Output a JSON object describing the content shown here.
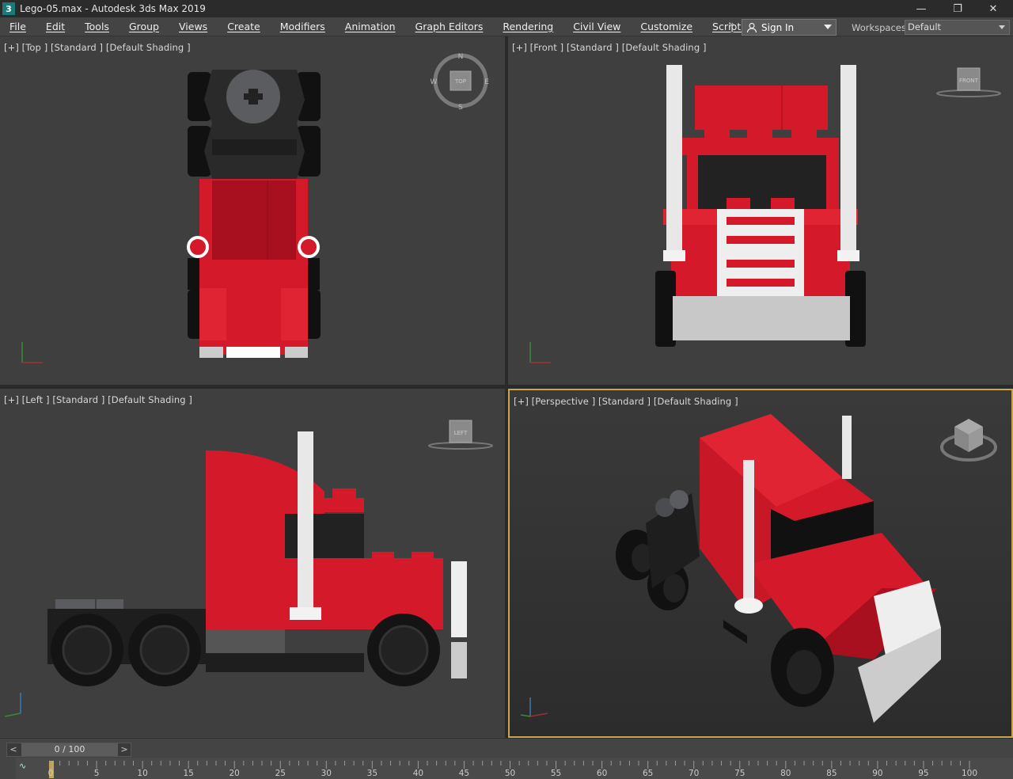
{
  "window": {
    "title": "Lego-05.max - Autodesk 3ds Max 2019",
    "app_icon": "3"
  },
  "menu": [
    "File",
    "Edit",
    "Tools",
    "Group",
    "Views",
    "Create",
    "Modifiers",
    "Animation",
    "Graph Editors",
    "Rendering",
    "Civil View",
    "Customize",
    "Scripting"
  ],
  "toolbar": {
    "overflow": "»",
    "sign_in": "Sign In",
    "workspaces_label": "Workspaces:",
    "workspace_value": "Default"
  },
  "viewports": {
    "top": {
      "label": "[+] [Top ] [Standard ] [Default Shading ]",
      "cube": "TOP",
      "compass": [
        "N",
        "E",
        "S",
        "W"
      ]
    },
    "front": {
      "label": "[+] [Front ] [Standard ] [Default Shading ]",
      "cube": "FRONT"
    },
    "left": {
      "label": "[+] [Left ] [Standard ] [Default Shading ]",
      "cube": "LEFT"
    },
    "perspective": {
      "label": "[+] [Perspective ] [Standard ] [Default Shading ]"
    }
  },
  "timeline": {
    "frame_display": "0 / 100",
    "ticks": [
      0,
      5,
      10,
      15,
      20,
      25,
      30,
      35,
      40,
      45,
      50,
      55,
      60,
      65,
      70,
      75,
      80,
      85,
      90,
      95,
      100
    ]
  },
  "colors": {
    "lego_red": "#d41a2a",
    "active_border": "#c8a650"
  }
}
